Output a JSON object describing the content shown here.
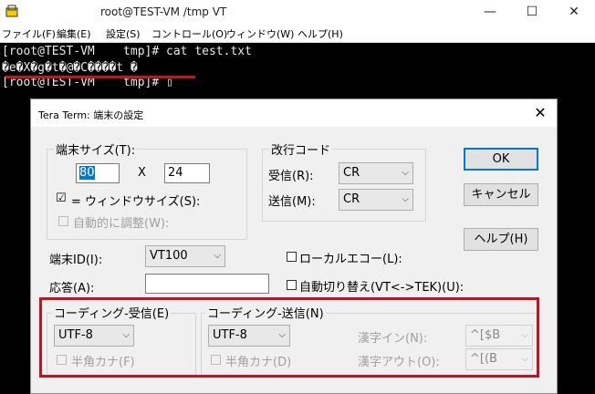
{
  "window": {
    "title": "root@TEST-VM     /tmp VT",
    "minimize_glyph": "—",
    "maximize_glyph": "☐",
    "close_glyph": "✕"
  },
  "menu": [
    "ファイル(F)",
    "編集(E)",
    "設定(S)",
    "コントロール(O)",
    "ウィンドウ(W)",
    "ヘルプ(H)"
  ],
  "terminal": {
    "lines": [
      "[root@TEST-VM    tmp]# cat test.txt",
      "�e�X�g�t�@�C����t �",
      "[root@TEST-VM    tmp]# ▯"
    ]
  },
  "dialog": {
    "title": "Tera Term: 端末の設定",
    "close_glyph": "✕",
    "terminal_size": {
      "group_label": "端末サイズ(T):",
      "cols": "80",
      "x_label": "X",
      "rows": "24",
      "window_size_label": "= ウィンドウサイズ(S):",
      "window_size_checked": "☑",
      "auto_adjust_label": "自動的に調整(W):"
    },
    "newline": {
      "group_label": "改行コード",
      "receive_label": "受信(R):",
      "receive_value": "CR",
      "send_label": "送信(M):",
      "send_value": "CR"
    },
    "buttons": {
      "ok": "OK",
      "cancel": "キャンセル",
      "help": "ヘルプ(H)"
    },
    "terminal_id_label": "端末ID(I):",
    "terminal_id_value": "VT100",
    "answerback_label": "応答(A):",
    "answerback_value": "",
    "local_echo_label": "ローカルエコー(L):",
    "auto_switch_label": "自動切り替え(VT<->TEK)(U):",
    "coding_receive": {
      "group_label": "コーディング-受信(E)",
      "value": "UTF-8",
      "half_kana_label": "半角カナ(F)"
    },
    "coding_send": {
      "group_label": "コーディング-送信(N)",
      "value": "UTF-8",
      "half_kana_label": "半角カナ(D)",
      "kanji_in_label": "漢字イン(N):",
      "kanji_in_value": "^[$B",
      "kanji_out_label": "漢字アウト(O):",
      "kanji_out_value": "^[(B"
    },
    "dropdown_arrow": "⌵"
  },
  "colors": {
    "highlight_red": "#c8101e",
    "selection_blue": "#0078d7"
  }
}
